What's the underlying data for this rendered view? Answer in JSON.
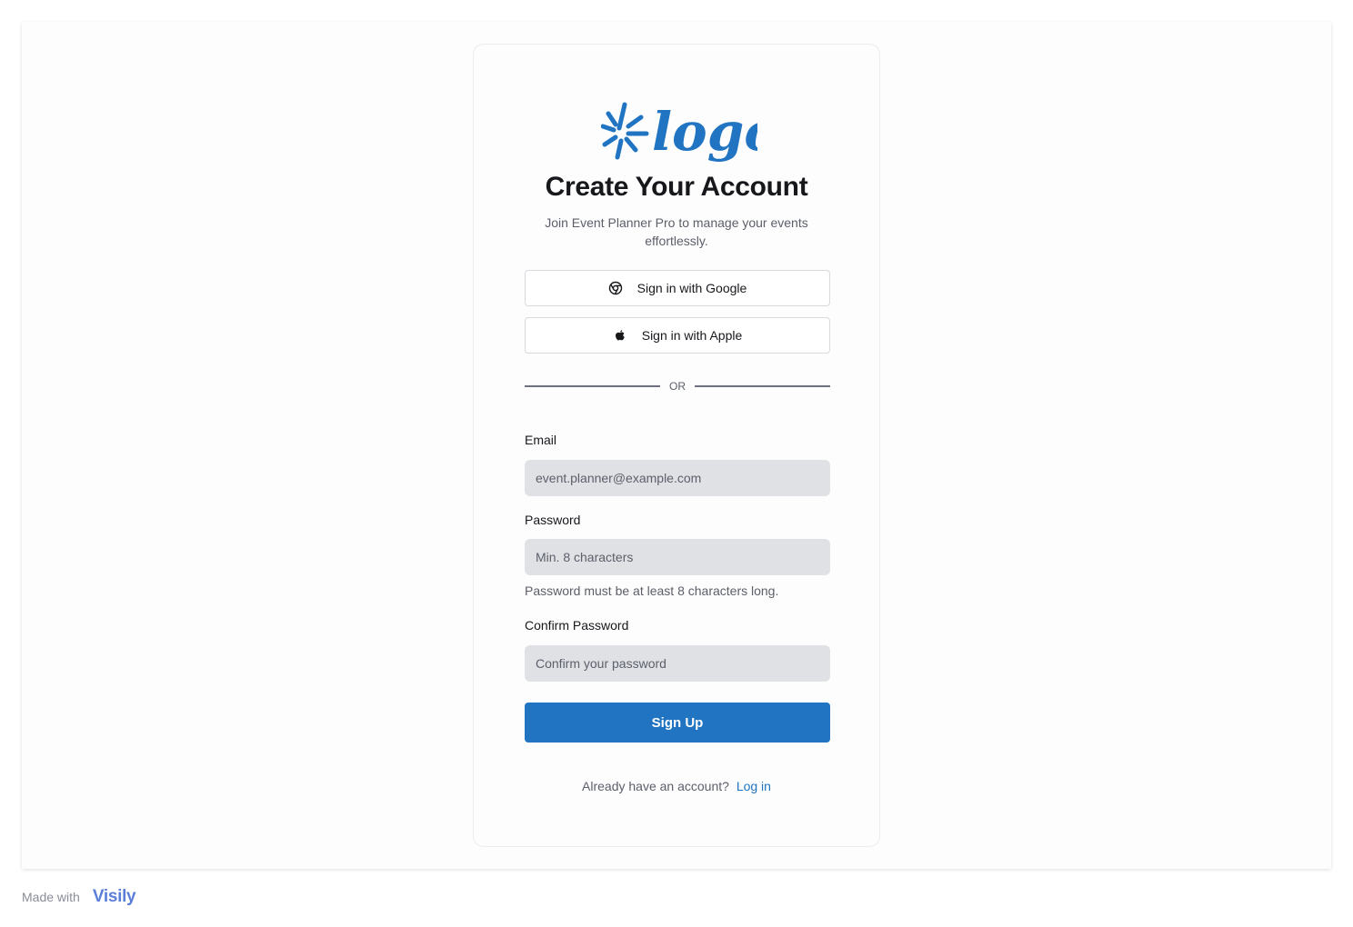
{
  "colors": {
    "accent": "#2074c2",
    "logo": "#2074c2",
    "input_bg": "#dfe1e5",
    "brand": "#5b7fd9"
  },
  "logo": {
    "icon": "logo-mark-icon",
    "text": "logo"
  },
  "header": {
    "title": "Create Your Account",
    "subtitle": "Join Event Planner Pro to manage your events effortlessly."
  },
  "oauth": {
    "google_label": "Sign in with Google",
    "google_icon": "chrome-icon",
    "apple_label": "Sign in with Apple",
    "apple_icon": "apple-icon"
  },
  "divider": {
    "label": "OR"
  },
  "form": {
    "email": {
      "label": "Email",
      "placeholder": "event.planner@example.com",
      "value": ""
    },
    "password": {
      "label": "Password",
      "placeholder": "Min. 8 characters",
      "value": "",
      "hint": "Password must be at least 8 characters long."
    },
    "confirm": {
      "label": "Confirm Password",
      "placeholder": "Confirm your password",
      "value": ""
    },
    "submit_label": "Sign Up"
  },
  "footer": {
    "prompt": "Already have an account?",
    "login_label": "Log in"
  },
  "made_with": {
    "text": "Made with",
    "brand": "Visily",
    "brand_icon": "visily-logo-icon"
  }
}
